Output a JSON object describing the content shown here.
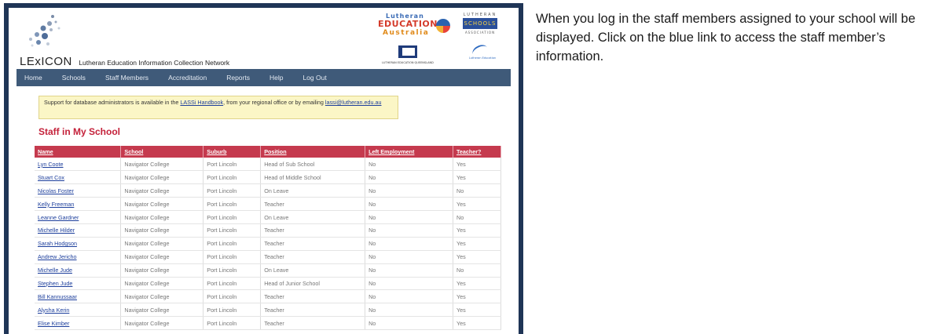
{
  "header": {
    "brand_name": "LExICON",
    "brand_full": "Lutheran Education Information Collection Network",
    "logo_lea": {
      "line1": "Lutheran",
      "line2": "EDUCATION",
      "line3": "Australia"
    },
    "logo_ls": {
      "top": "LUTHERAN",
      "mid": "SCHOOLS",
      "bot": "ASSOCIATION"
    },
    "logo_leq": {
      "caption": "LUTHERAN EDUCATION QUEENSLAND"
    },
    "logo_lesa": {
      "caption": "Lutheran Education"
    }
  },
  "nav": {
    "items": [
      "Home",
      "Schools",
      "Staff Members",
      "Accreditation",
      "Reports",
      "Help",
      "Log Out"
    ]
  },
  "notice": {
    "text_before": "Support for database administrators is available in the ",
    "link_handbook": "LASSi Handbook",
    "text_after": ", from your regional office or by emailing ",
    "link_email": "lassi@lutheran.edu.au"
  },
  "page_title": "Staff in My School",
  "table": {
    "headers": [
      "Name",
      "School",
      "Suburb",
      "Position",
      "Left Employment",
      "Teacher?"
    ],
    "rows": [
      [
        "Lyn Coote",
        "Navigator College",
        "Port Lincoln",
        "Head of Sub School",
        "No",
        "Yes"
      ],
      [
        "Stuart Cox",
        "Navigator College",
        "Port Lincoln",
        "Head of Middle School",
        "No",
        "Yes"
      ],
      [
        "Nicolas Foster",
        "Navigator College",
        "Port Lincoln",
        "On Leave",
        "No",
        "No"
      ],
      [
        "Kelly Freeman",
        "Navigator College",
        "Port Lincoln",
        "Teacher",
        "No",
        "Yes"
      ],
      [
        "Leanne Gardner",
        "Navigator College",
        "Port Lincoln",
        "On Leave",
        "No",
        "No"
      ],
      [
        "Michelle Hilder",
        "Navigator College",
        "Port Lincoln",
        "Teacher",
        "No",
        "Yes"
      ],
      [
        "Sarah Hodgson",
        "Navigator College",
        "Port Lincoln",
        "Teacher",
        "No",
        "Yes"
      ],
      [
        "Andrew Jericho",
        "Navigator College",
        "Port Lincoln",
        "Teacher",
        "No",
        "Yes"
      ],
      [
        "Michelle Jude",
        "Navigator College",
        "Port Lincoln",
        "On Leave",
        "No",
        "No"
      ],
      [
        "Stephen Jude",
        "Navigator College",
        "Port Lincoln",
        "Head of Junior School",
        "No",
        "Yes"
      ],
      [
        "Bill Kannussaar",
        "Navigator College",
        "Port Lincoln",
        "Teacher",
        "No",
        "Yes"
      ],
      [
        "Alysha Kerin",
        "Navigator College",
        "Port Lincoln",
        "Teacher",
        "No",
        "Yes"
      ],
      [
        "Elise Kimber",
        "Navigator College",
        "Port Lincoln",
        "Teacher",
        "No",
        "Yes"
      ]
    ]
  },
  "caption": "When you log in the staff members assigned to your school will be displayed. Click on the blue link to access the staff member’s information.",
  "colors": {
    "frame": "#1f3556",
    "nav": "#3f5a79",
    "table_header": "#c53a4e",
    "title": "#c4213a",
    "link": "#1d3f9c"
  }
}
